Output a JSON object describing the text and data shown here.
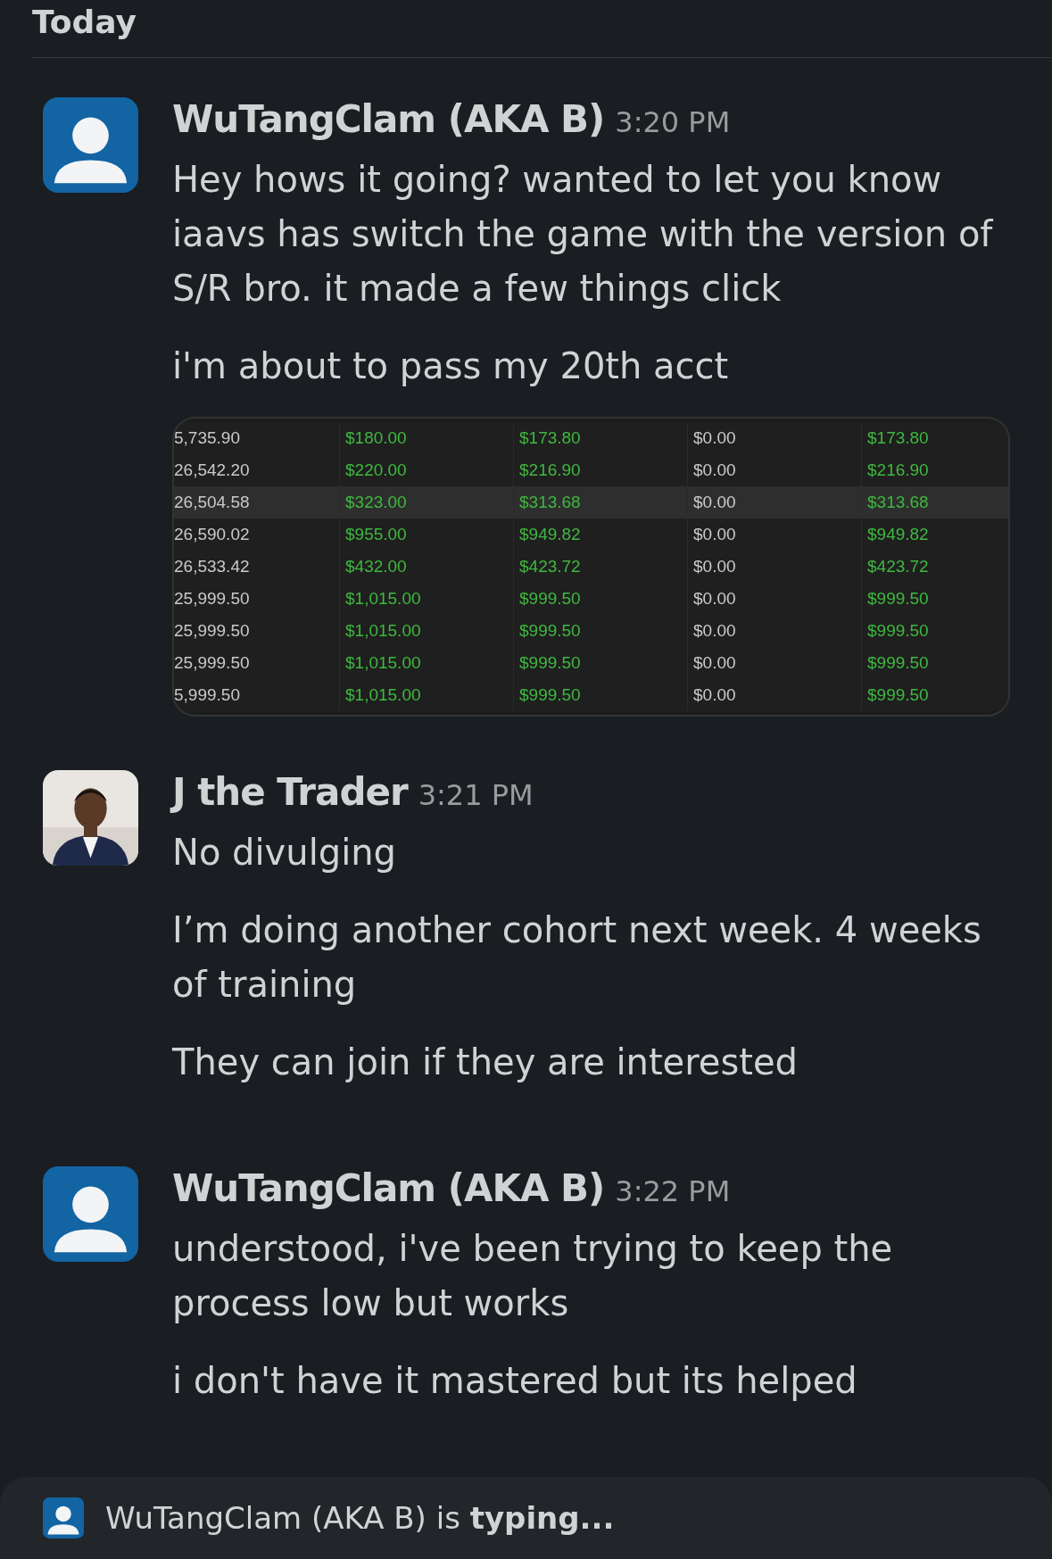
{
  "date_divider": "Today",
  "messages": [
    {
      "author": "WuTangClam (AKA B)",
      "kind": "default_avatar",
      "time": "3:20 PM",
      "paragraphs": [
        "Hey hows it going? wanted to let you know iaavs has switch the game with the version of S/R bro. it made a few things click",
        "i'm about to pass my 20th acct"
      ],
      "attachment": {
        "columns": [
          {
            "kind": "plain"
          },
          {
            "kind": "money"
          },
          {
            "kind": "money"
          },
          {
            "kind": "plain"
          },
          {
            "kind": "money"
          }
        ],
        "rows": [
          {
            "selected": false,
            "cells": [
              "5,735.90",
              "$180.00",
              "$173.80",
              "$0.00",
              "$173.80"
            ]
          },
          {
            "selected": false,
            "cells": [
              "26,542.20",
              "$220.00",
              "$216.90",
              "$0.00",
              "$216.90"
            ]
          },
          {
            "selected": true,
            "cells": [
              "26,504.58",
              "$323.00",
              "$313.68",
              "$0.00",
              "$313.68"
            ]
          },
          {
            "selected": false,
            "cells": [
              "26,590.02",
              "$955.00",
              "$949.82",
              "$0.00",
              "$949.82"
            ]
          },
          {
            "selected": false,
            "cells": [
              "26,533.42",
              "$432.00",
              "$423.72",
              "$0.00",
              "$423.72"
            ]
          },
          {
            "selected": false,
            "cells": [
              "25,999.50",
              "$1,015.00",
              "$999.50",
              "$0.00",
              "$999.50"
            ]
          },
          {
            "selected": false,
            "cells": [
              "25,999.50",
              "$1,015.00",
              "$999.50",
              "$0.00",
              "$999.50"
            ]
          },
          {
            "selected": false,
            "cells": [
              "25,999.50",
              "$1,015.00",
              "$999.50",
              "$0.00",
              "$999.50"
            ]
          },
          {
            "selected": false,
            "cells": [
              "5,999.50",
              "$1,015.00",
              "$999.50",
              "$0.00",
              "$999.50"
            ]
          }
        ]
      }
    },
    {
      "author": "J the Trader",
      "kind": "photo_avatar",
      "time": "3:21 PM",
      "paragraphs": [
        "No divulging",
        "I’m doing another cohort next week. 4 weeks of training",
        "They can join if they are interested"
      ]
    },
    {
      "author": "WuTangClam (AKA B)",
      "kind": "default_avatar",
      "time": "3:22 PM",
      "paragraphs": [
        "understood, i've been trying to keep the process low but works",
        "i don't have it mastered but its helped"
      ]
    }
  ],
  "typing_indicator": "WuTangClam (AKA B) is **typing...**"
}
